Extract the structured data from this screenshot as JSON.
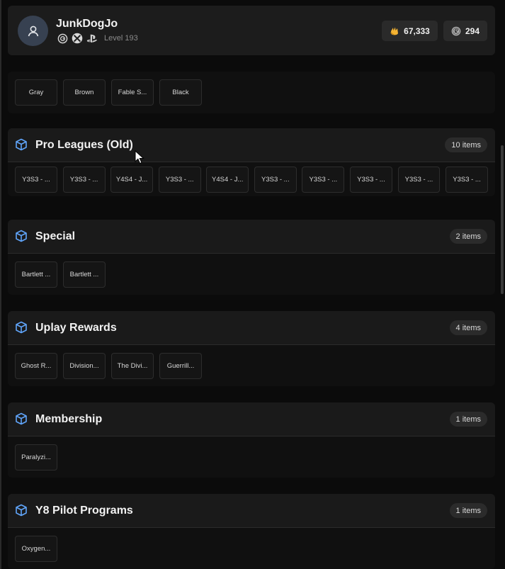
{
  "header": {
    "username": "JunkDogJo",
    "level_text": "Level 193",
    "renown": "67,333",
    "credits": "294",
    "platforms": [
      "ubisoft-icon",
      "xbox-icon",
      "playstation-icon"
    ]
  },
  "colors": {
    "accent": "#60a5fa",
    "renown": "#f5b433",
    "panel_bg": "#1a1a1a"
  },
  "top_panel": {
    "items": [
      "Gray",
      "Brown",
      "Fable S...",
      "Black"
    ]
  },
  "categories": [
    {
      "title": "Pro Leagues (Old)",
      "badge": "10 items",
      "items": [
        "Y3S3 - ...",
        "Y3S3 - ...",
        "Y4S4 - J...",
        "Y3S3 - ...",
        "Y4S4 - J...",
        "Y3S3 - ...",
        "Y3S3 - ...",
        "Y3S3 - ...",
        "Y3S3 - ...",
        "Y3S3 - ..."
      ]
    },
    {
      "title": "Special",
      "badge": "2 items",
      "items": [
        "Bartlett ...",
        "Bartlett ..."
      ]
    },
    {
      "title": "Uplay Rewards",
      "badge": "4 items",
      "items": [
        "Ghost R...",
        "Division...",
        "The Divi...",
        "Guerrill..."
      ]
    },
    {
      "title": "Membership",
      "badge": "1 items",
      "items": [
        "Paralyzi..."
      ]
    },
    {
      "title": "Y8 Pilot Programs",
      "badge": "1 items",
      "items": [
        "Oxygen..."
      ]
    }
  ]
}
